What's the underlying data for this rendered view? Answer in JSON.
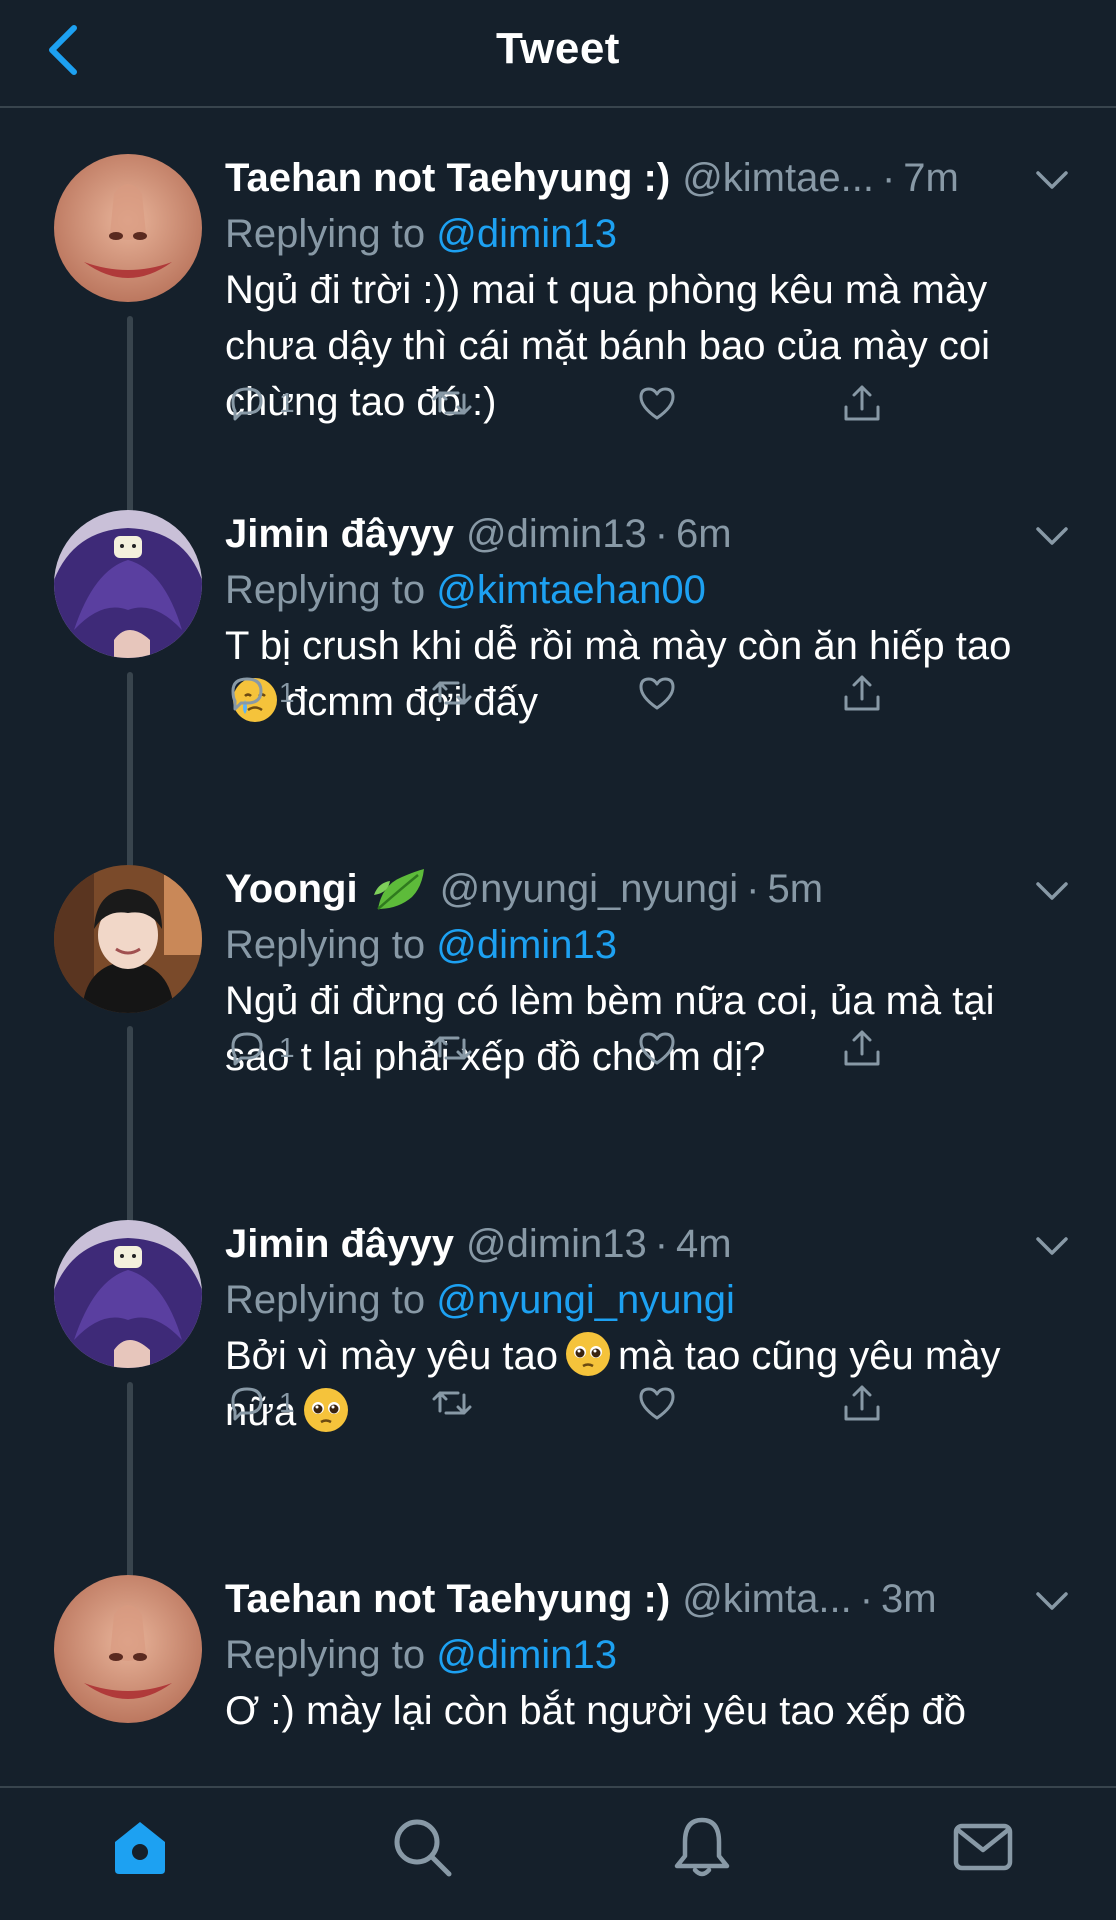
{
  "header": {
    "title": "Tweet",
    "back_icon": "chevron-left-icon"
  },
  "colors": {
    "background": "#15202b",
    "accent": "#1da1f2",
    "muted": "#8899a6",
    "divider": "#38444d"
  },
  "tweets": [
    {
      "display_name": "Taehan not Taehyung :)",
      "handle": "@kimtae...",
      "separator": "·",
      "time": "7m",
      "replying_prefix": "Replying to",
      "replying_to": "@dimin13",
      "text": "Ngủ đi trời :)) mai t qua phòng kêu mà mày chưa dậy thì cái mặt bánh bao của mày coi chừng tao đó :)",
      "reply_count": "1"
    },
    {
      "display_name": "Jimin đâyyy",
      "handle": "@dimin13",
      "separator": "·",
      "time": "6m",
      "replying_prefix": "Replying to",
      "replying_to": "@kimtaehan00",
      "text_part1": "T bị crush khi dễ rồi mà mày còn ăn hiếp tao",
      "text_emoji": "crying-face",
      "text_part2": "đcmm đợi đấy",
      "reply_count": "1"
    },
    {
      "display_name": "Yoongi",
      "name_emoji": "leaf-emoji",
      "handle": "@nyungi_nyungi",
      "separator": "·",
      "time": "5m",
      "replying_prefix": "Replying to",
      "replying_to": "@dimin13",
      "text": "Ngủ đi đừng có lèm bèm nữa coi, ủa mà tại sao t lại phải xếp đồ cho m dị?",
      "reply_count": "1"
    },
    {
      "display_name": "Jimin đâyyy",
      "handle": "@dimin13",
      "separator": "·",
      "time": "4m",
      "replying_prefix": "Replying to",
      "replying_to": "@nyungi_nyungi",
      "text_part1": "Bởi vì mày yêu tao",
      "text_emoji": "pleading-face",
      "text_part2": "mà tao cũng yêu mày nữa",
      "text_emoji2": "pleading-face",
      "reply_count": "1"
    },
    {
      "display_name": "Taehan not Taehyung :)",
      "handle": "@kimta...",
      "separator": "·",
      "time": "3m",
      "replying_prefix": "Replying to",
      "replying_to": "@dimin13",
      "text": "Ơ :) mày lại còn bắt người yêu tao xếp đồ"
    }
  ],
  "tabbar": {
    "items": [
      "home-icon",
      "search-icon",
      "bell-icon",
      "mail-icon"
    ],
    "active": "home-icon"
  }
}
